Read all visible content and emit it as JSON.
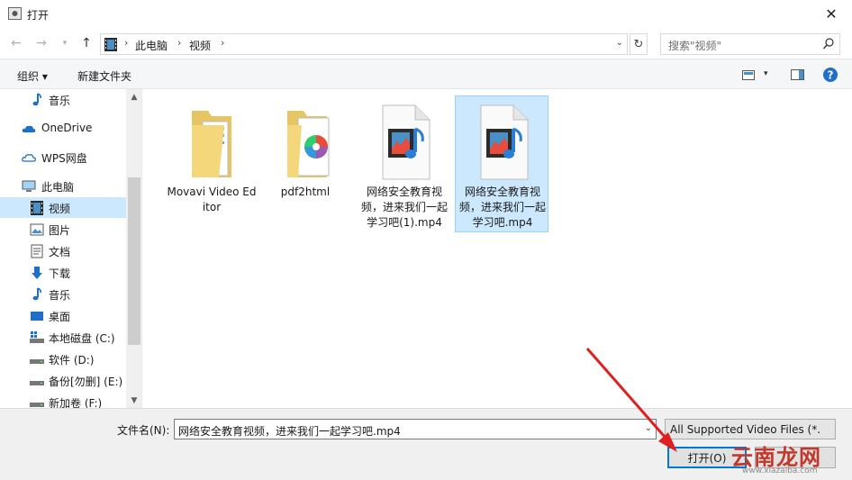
{
  "window": {
    "title": "打开"
  },
  "address": {
    "crumbs": [
      "此电脑",
      "视频"
    ],
    "search_placeholder": "搜索\"视频\""
  },
  "toolbar": {
    "organize_label": "组织 ▾",
    "new_folder_label": "新建文件夹"
  },
  "nav": {
    "items": [
      {
        "label": "音乐",
        "icon": "music-icon"
      },
      {
        "label": "OneDrive",
        "icon": "cloud-icon"
      },
      {
        "label": "WPS网盘",
        "icon": "wps-cloud-icon"
      },
      {
        "label": "此电脑",
        "icon": "computer-icon"
      },
      {
        "label": "视频",
        "icon": "video-folder-icon",
        "selected": true
      },
      {
        "label": "图片",
        "icon": "pictures-icon"
      },
      {
        "label": "文档",
        "icon": "documents-icon"
      },
      {
        "label": "下载",
        "icon": "download-icon"
      },
      {
        "label": "音乐",
        "icon": "music-icon"
      },
      {
        "label": "桌面",
        "icon": "desktop-icon"
      },
      {
        "label": "本地磁盘 (C:)",
        "icon": "system-drive-icon"
      },
      {
        "label": "软件 (D:)",
        "icon": "drive-icon"
      },
      {
        "label": "备份[勿删] (E:)",
        "icon": "drive-icon"
      },
      {
        "label": "新加卷 (F:)",
        "icon": "drive-icon"
      }
    ]
  },
  "files": [
    {
      "name": "Movavi Video Editor",
      "type": "folder"
    },
    {
      "name": "pdf2html",
      "type": "folder"
    },
    {
      "name": "网络安全教育视频，进来我们一起学习吧(1).mp4",
      "type": "video"
    },
    {
      "name": "网络安全教育视频，进来我们一起学习吧.mp4",
      "type": "video",
      "selected": true
    }
  ],
  "bottom": {
    "filename_label": "文件名(N):",
    "filename_value": "网络安全教育视频，进来我们一起学习吧.mp4",
    "filter_value": "All Supported Video Files (*.",
    "open_label": "打开(O)"
  },
  "watermark": {
    "text": "云南龙网",
    "url": "www.xiazaiba.com"
  },
  "colors": {
    "selection": "#cce8ff",
    "selection_border": "#99d1ff",
    "accent": "#0078d7",
    "arrow": "#e02020"
  }
}
